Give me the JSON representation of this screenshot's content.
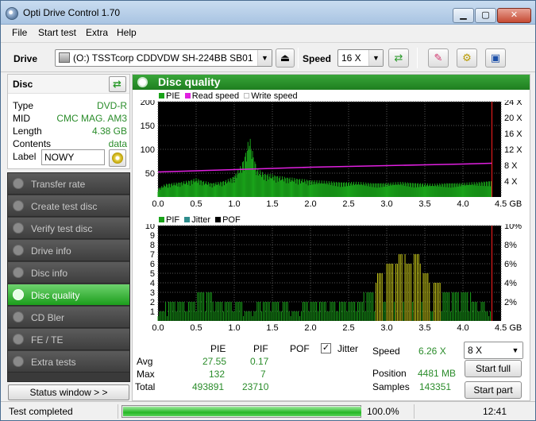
{
  "window": {
    "title": "Opti Drive Control 1.70"
  },
  "menu": [
    "File",
    "Start test",
    "Extra",
    "Help"
  ],
  "toolbar": {
    "drive_label": "Drive",
    "drive_value": "(O:)  TSSTcorp CDDVDW SH-224BB SB01",
    "speed_label": "Speed",
    "speed_value": "16 X"
  },
  "disc": {
    "header": "Disc",
    "rows": [
      {
        "k": "Type",
        "v": "DVD-R"
      },
      {
        "k": "MID",
        "v": "CMC MAG. AM3"
      },
      {
        "k": "Length",
        "v": "4.38 GB"
      },
      {
        "k": "Contents",
        "v": "data"
      }
    ],
    "label_key": "Label",
    "label_value": "NOWY"
  },
  "nav": [
    {
      "label": "Transfer rate",
      "active": false
    },
    {
      "label": "Create test disc",
      "active": false
    },
    {
      "label": "Verify test disc",
      "active": false
    },
    {
      "label": "Drive info",
      "active": false
    },
    {
      "label": "Disc info",
      "active": false
    },
    {
      "label": "Disc quality",
      "active": true
    },
    {
      "label": "CD Bler",
      "active": false
    },
    {
      "label": "FE / TE",
      "active": false
    },
    {
      "label": "Extra tests",
      "active": false
    }
  ],
  "status_window_button": "Status window > >",
  "panel_title": "Disc quality",
  "chart_data": [
    {
      "type": "area",
      "legend": [
        {
          "name": "PIE",
          "color": "#1aa31a"
        },
        {
          "name": "Read speed",
          "color": "#e020e0"
        },
        {
          "name": "Write speed",
          "color": "#ffffff"
        }
      ],
      "x_ticks": [
        "0.0",
        "0.5",
        "1.0",
        "1.5",
        "2.0",
        "2.5",
        "3.0",
        "3.5",
        "4.0",
        "4.5 GB"
      ],
      "y_ticks_left": [
        "200",
        "150",
        "100",
        "50"
      ],
      "y_ticks_right": [
        "24 X",
        "20 X",
        "16 X",
        "12 X",
        "8 X",
        "4 X"
      ],
      "xlim": [
        0,
        4.5
      ],
      "ylim": [
        0,
        200
      ],
      "series": [
        {
          "name": "PIE",
          "x": [
            0.0,
            0.1,
            0.2,
            0.3,
            0.4,
            0.5,
            0.6,
            0.7,
            0.8,
            0.9,
            1.0,
            1.1,
            1.15,
            1.2,
            1.25,
            1.3,
            1.4,
            1.5,
            1.6,
            1.7,
            1.8,
            1.9,
            2.0,
            2.2,
            2.4,
            2.6,
            2.8,
            3.0,
            3.2,
            3.4,
            3.6,
            3.8,
            4.0,
            4.2,
            4.38
          ],
          "values": [
            18,
            28,
            30,
            32,
            35,
            40,
            34,
            30,
            32,
            36,
            45,
            70,
            95,
            130,
            90,
            60,
            50,
            48,
            44,
            42,
            40,
            38,
            36,
            34,
            32,
            32,
            30,
            30,
            32,
            30,
            28,
            30,
            30,
            32,
            35
          ]
        },
        {
          "name": "Read speed",
          "x": [
            0.0,
            0.5,
            1.0,
            1.5,
            2.0,
            2.5,
            3.0,
            3.5,
            4.0,
            4.38
          ],
          "values": [
            6.3,
            6.6,
            6.9,
            7.2,
            7.5,
            7.7,
            7.9,
            8.1,
            8.3,
            8.5
          ]
        }
      ]
    },
    {
      "type": "bar",
      "legend": [
        {
          "name": "PIF",
          "color": "#1aa31a"
        },
        {
          "name": "Jitter",
          "color": "#2e8c8c"
        },
        {
          "name": "POF",
          "color": "#000000"
        }
      ],
      "x_ticks": [
        "0.0",
        "0.5",
        "1.0",
        "1.5",
        "2.0",
        "2.5",
        "3.0",
        "3.5",
        "4.0",
        "4.5 GB"
      ],
      "y_ticks_left": [
        "10",
        "9",
        "8",
        "7",
        "6",
        "5",
        "4",
        "3",
        "2",
        "1"
      ],
      "y_ticks_right": [
        "10%",
        "8%",
        "6%",
        "4%",
        "2%"
      ],
      "xlim": [
        0,
        4.5
      ],
      "ylim": [
        0,
        10
      ],
      "series": [
        {
          "name": "PIF",
          "x": [
            0.0,
            0.2,
            0.4,
            0.6,
            0.8,
            1.0,
            1.2,
            1.4,
            1.6,
            1.8,
            2.0,
            2.2,
            2.4,
            2.6,
            2.8,
            2.9,
            3.0,
            3.1,
            3.2,
            3.3,
            3.4,
            3.5,
            3.6,
            3.8,
            4.0,
            4.2,
            4.38
          ],
          "values": [
            1,
            2,
            2,
            3,
            2,
            2,
            1,
            2,
            2,
            1,
            2,
            2,
            2,
            2,
            3,
            5,
            6,
            6,
            7,
            6,
            7,
            5,
            4,
            3,
            3,
            2,
            1
          ]
        }
      ]
    }
  ],
  "stats": {
    "headers": [
      "PIE",
      "PIF",
      "POF",
      "Jitter"
    ],
    "rows": [
      {
        "label": "Avg",
        "pie": "27.55",
        "pif": "0.17"
      },
      {
        "label": "Max",
        "pie": "132",
        "pif": "7"
      },
      {
        "label": "Total",
        "pie": "493891",
        "pif": "23710"
      }
    ],
    "speed_label": "Speed",
    "speed_value": "6.26 X",
    "position_label": "Position",
    "position_value": "4481 MB",
    "samples_label": "Samples",
    "samples_value": "143351",
    "speed_select": "8 X",
    "start_full": "Start full",
    "start_part": "Start part"
  },
  "status": {
    "text": "Test completed",
    "progress": 100,
    "progress_text": "100.0%",
    "time": "12:41"
  }
}
